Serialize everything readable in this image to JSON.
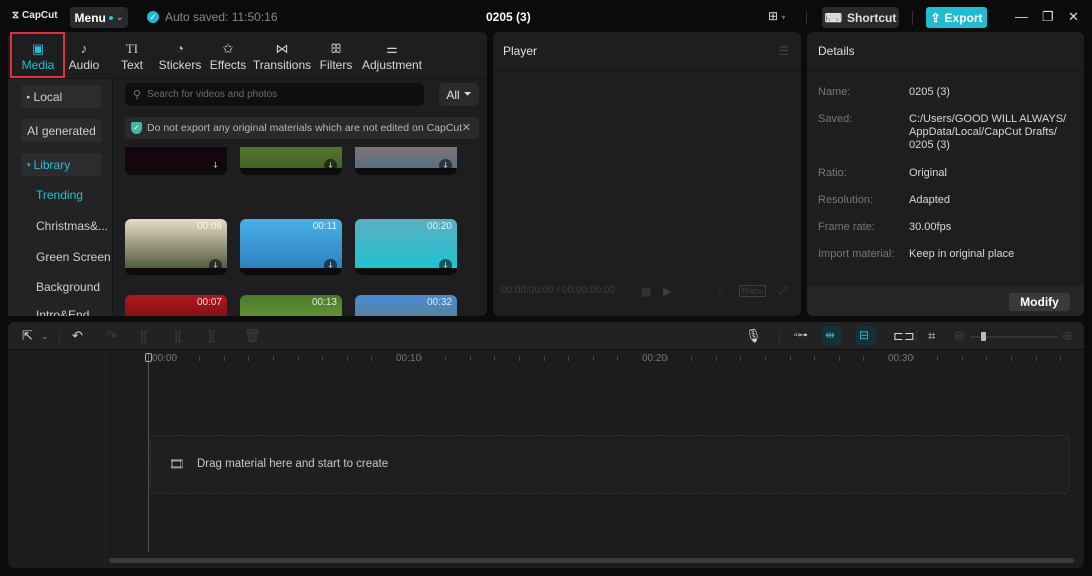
{
  "app": {
    "logo": "CapCut",
    "menu_label": "Menu",
    "autosave_text": "Auto saved: 11:50:16",
    "project_title": "0205 (3)",
    "shortcut_label": "Shortcut",
    "export_label": "Export"
  },
  "tabs": [
    {
      "label": "Media",
      "icon": "media-icon",
      "glyph": "▣",
      "active": true
    },
    {
      "label": "Audio",
      "icon": "audio-icon",
      "glyph": "♪"
    },
    {
      "label": "Text",
      "icon": "text-icon",
      "glyph": "TI"
    },
    {
      "label": "Stickers",
      "icon": "sticker-icon",
      "glyph": "◔"
    },
    {
      "label": "Effects",
      "icon": "effects-icon",
      "glyph": "✩"
    },
    {
      "label": "Transitions",
      "icon": "transitions-icon",
      "glyph": "⋈"
    },
    {
      "label": "Filters",
      "icon": "filters-icon",
      "glyph": "ꕥ"
    },
    {
      "label": "Adjustment",
      "icon": "adjustment-icon",
      "glyph": "⚌"
    }
  ],
  "sidebar": {
    "local": "Local",
    "ai_generated": "AI generated",
    "library": "Library",
    "subitems": [
      "Trending",
      "Christmas&...",
      "Green Screen",
      "Background",
      "Intro&End"
    ]
  },
  "search": {
    "placeholder": "Search for videos and photos",
    "filter_label": "All"
  },
  "notice": {
    "text": "Do not export any original materials which are not edited on CapCut"
  },
  "thumbnails": [
    {
      "duration": "",
      "colors": [
        "#0a0510",
        "#1a0610"
      ]
    },
    {
      "duration": "",
      "colors": [
        "#6b8a3a",
        "#3e5e22"
      ]
    },
    {
      "duration": "",
      "colors": [
        "#b8795a",
        "#4a6d8a"
      ]
    },
    {
      "duration": "00:06",
      "colors": [
        "#e8dcc8",
        "#3d4a2a"
      ]
    },
    {
      "duration": "00:11",
      "colors": [
        "#4ab0e8",
        "#2a7ab8"
      ]
    },
    {
      "duration": "00:20",
      "colors": [
        "#5ab0c0",
        "#18c4d4"
      ]
    },
    {
      "duration": "00:07",
      "colors": [
        "#b0181c",
        "#3a0808"
      ]
    },
    {
      "duration": "00:13",
      "colors": [
        "#4a7a2a",
        "#8ab84a"
      ]
    },
    {
      "duration": "00:32",
      "colors": [
        "#4a8ad8",
        "#6a7a3a"
      ]
    }
  ],
  "player": {
    "title": "Player",
    "timecode": "00:00:00:00 / 00:00:00:00",
    "ratio_label": "Ratio"
  },
  "details": {
    "title": "Details",
    "rows": [
      {
        "label": "Name:",
        "value": "0205 (3)"
      },
      {
        "label": "Saved:",
        "value": "C:/Users/GOOD WILL ALWAYS/ AppData/Local/CapCut Drafts/ 0205 (3)"
      },
      {
        "label": "Ratio:",
        "value": "Original"
      },
      {
        "label": "Resolution:",
        "value": "Adapted"
      },
      {
        "label": "Frame rate:",
        "value": "30.00fps"
      },
      {
        "label": "Import material:",
        "value": "Keep in original place"
      }
    ],
    "modify_label": "Modify"
  },
  "timeline": {
    "ruler": [
      "00:00",
      "00:10",
      "00:20",
      "00:30"
    ],
    "zoom_level": 0.35,
    "dropzone_text": "Drag material here and start to create"
  }
}
